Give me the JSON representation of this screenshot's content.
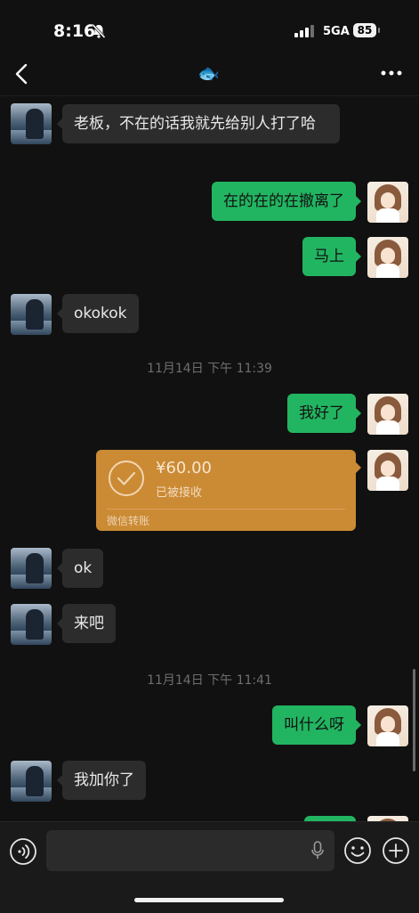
{
  "status_bar": {
    "time": "8:16",
    "network": "5GA",
    "battery": "85"
  },
  "nav": {
    "title_emoji": "🐟"
  },
  "messages": [
    {
      "side": "left",
      "text": "老板，不在的话我就先给别人打了哈"
    },
    {
      "side": "right",
      "text": "在的在的在撤离了"
    },
    {
      "side": "right",
      "text": "马上"
    },
    {
      "side": "left",
      "text": "okokok"
    },
    {
      "type": "time",
      "text": "11月14日 下午 11:39"
    },
    {
      "side": "right",
      "text": "我好了"
    },
    {
      "type": "transfer",
      "amount": "¥60.00",
      "status": "已被接收",
      "label": "微信转账"
    },
    {
      "side": "left",
      "text": "ok"
    },
    {
      "side": "left",
      "text": "来吧"
    },
    {
      "type": "time",
      "text": "11月14日 下午 11:41"
    },
    {
      "side": "right",
      "text": "叫什么呀"
    },
    {
      "side": "left",
      "text": "我加你了"
    }
  ],
  "input_bar": {
    "placeholder": ""
  },
  "colors": {
    "background": "#111111",
    "bubble_self": "#22b561",
    "bubble_other": "#2c2c2c",
    "transfer": "#cb8a34"
  }
}
